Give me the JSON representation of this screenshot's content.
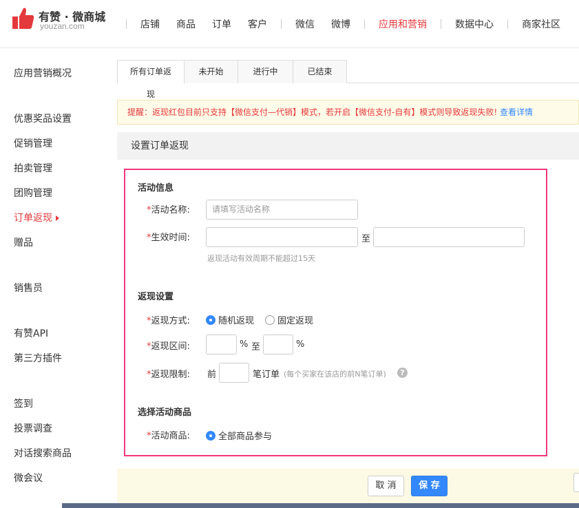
{
  "brand": {
    "name_cn": "有赞 · 微商城",
    "domain": "youzan.com",
    "logo_color": "#e4393c"
  },
  "nav": {
    "items": [
      {
        "label": "店铺"
      },
      {
        "label": "商品"
      },
      {
        "label": "订单"
      },
      {
        "label": "客户"
      },
      {
        "label": "微信"
      },
      {
        "label": "微博"
      },
      {
        "label": "应用和营销",
        "active": true
      },
      {
        "label": "数据中心"
      },
      {
        "label": "商家社区"
      }
    ]
  },
  "sidebar": {
    "items": [
      "应用营销概况",
      "优惠奖品设置",
      "促销管理",
      "拍卖管理",
      "团购管理",
      "订单返现",
      "赠品",
      "销售员",
      "有赞API",
      "第三方插件",
      "签到",
      "投票调查",
      "对话搜索商品",
      "微会议"
    ],
    "active_index": 5
  },
  "tabs": [
    {
      "label": "所有订单返现",
      "active": true
    },
    {
      "label": "未开始"
    },
    {
      "label": "进行中"
    },
    {
      "label": "已结束"
    }
  ],
  "notice": {
    "text": "提醒：返现红包目前只支持【微信支付—代销】模式，若开启【微信支付-自有】模式则导致返现失败!",
    "link": "查看详情"
  },
  "section_title": "设置订单返现",
  "form": {
    "activity_info": {
      "title": "活动信息",
      "name_label": "活动名称:",
      "name_placeholder": "请填写活动名称",
      "time_label": "生效时间:",
      "time_to": "至",
      "time_hint": "返现活动有效周期不能超过15天"
    },
    "cashback": {
      "title": "返现设置",
      "method_label": "返现方式:",
      "method_options": [
        "随机返现",
        "固定返现"
      ],
      "method_selected": 0,
      "range_label": "返现区间:",
      "range_pct1": "%",
      "range_to": "至",
      "range_pct2": "%",
      "limit_label": "返现限制:",
      "limit_prefix": "前",
      "limit_suffix": "笔订单",
      "limit_hint": "(每个买家在该店的前N笔订单)",
      "help_glyph": "?"
    },
    "products": {
      "title": "选择活动商品",
      "label": "活动商品:",
      "option": "全部商品参与"
    },
    "required_mark": "*"
  },
  "actions": {
    "cancel": "取 消",
    "save": "保 存"
  },
  "colors": {
    "accent": "#e4393c",
    "primary": "#3388ff",
    "highlight_border": "#f0367a"
  }
}
